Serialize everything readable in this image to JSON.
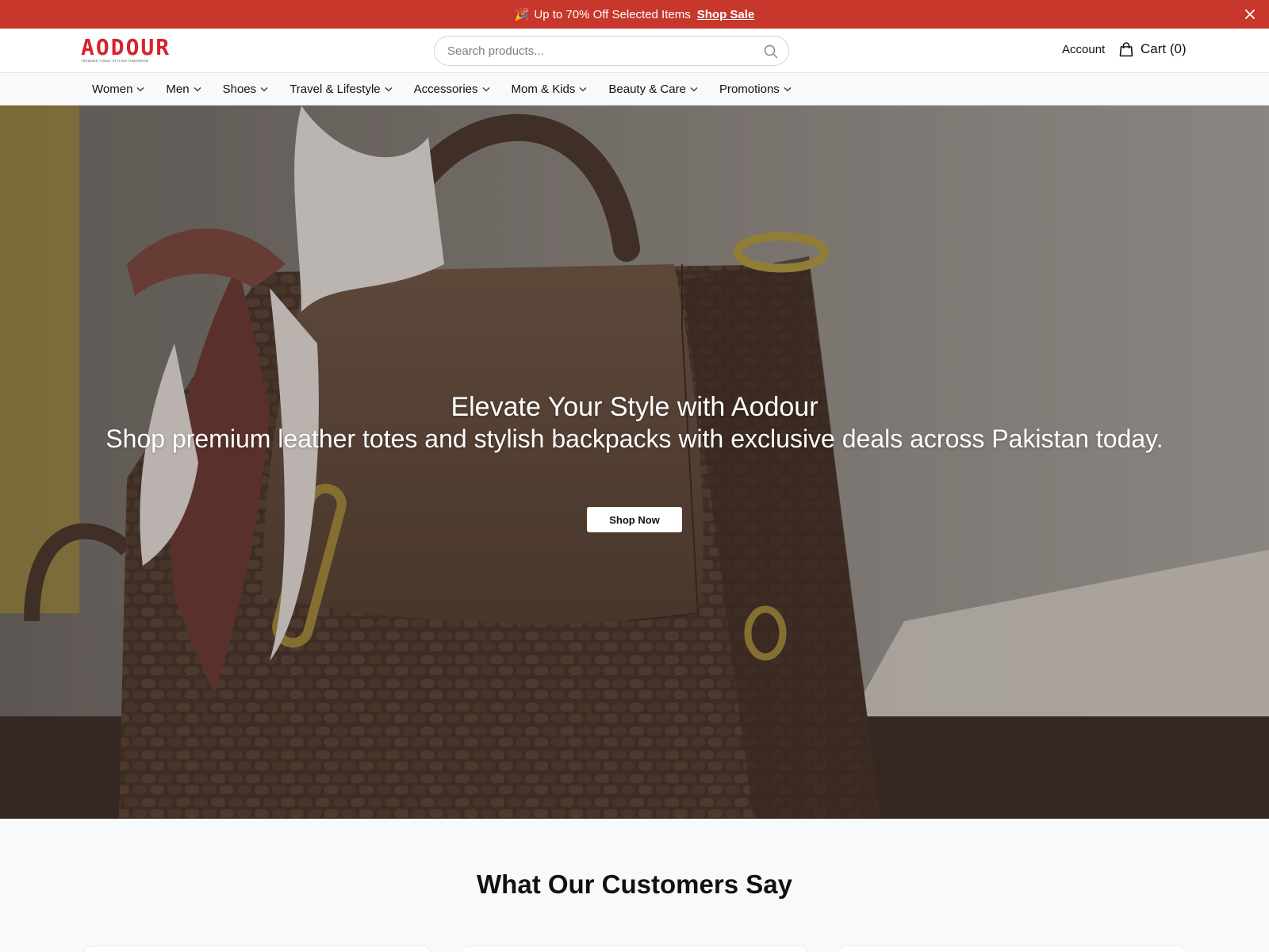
{
  "announcement": {
    "emoji": "🎉",
    "text": "Up to 70% Off Selected Items",
    "link": "Shop Sale"
  },
  "header": {
    "logo_text": "AODOUR",
    "logo_tagline": "TRENDIER TODAY, STYLISH TOMORROW",
    "search_placeholder": "Search products...",
    "account_label": "Account",
    "cart_label": "Cart (0)"
  },
  "nav": {
    "items": [
      {
        "label": "Women"
      },
      {
        "label": "Men"
      },
      {
        "label": "Shoes"
      },
      {
        "label": "Travel & Lifestyle"
      },
      {
        "label": "Accessories"
      },
      {
        "label": "Mom & Kids"
      },
      {
        "label": "Beauty & Care"
      },
      {
        "label": "Promotions"
      }
    ]
  },
  "hero": {
    "title": "Elevate Your Style with Aodour",
    "subtitle": "Shop premium leather totes and stylish backpacks with exclusive deals across Pakistan today.",
    "cta": "Shop Now"
  },
  "testimonials": {
    "heading": "What Our Customers Say"
  },
  "colors": {
    "announcement_bg": "#c7372c",
    "brand_red": "#d6242b"
  }
}
